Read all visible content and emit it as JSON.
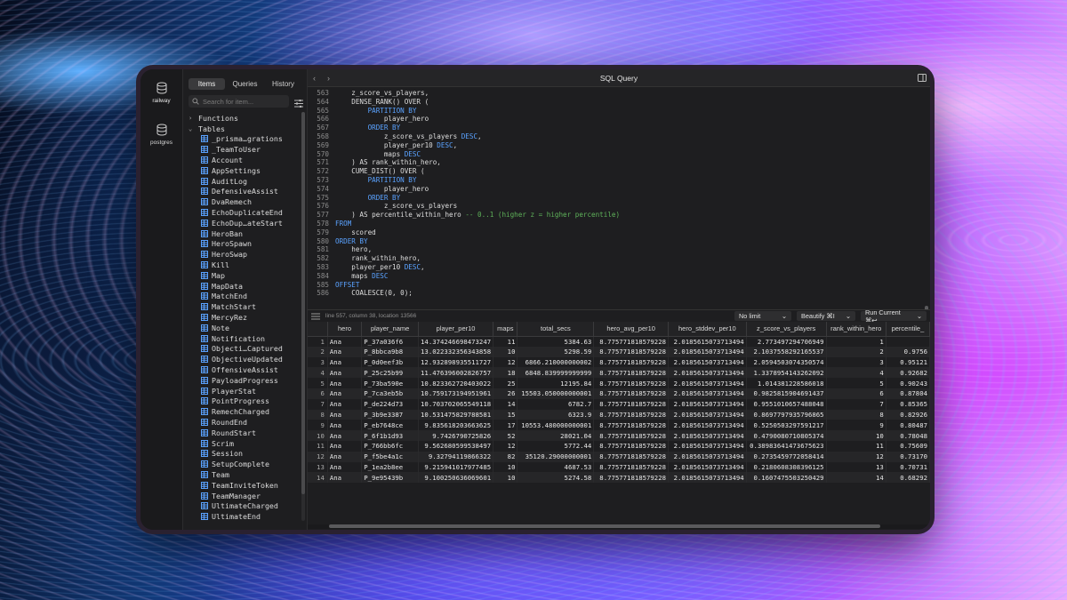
{
  "connections": [
    {
      "name": "railway",
      "active": true
    },
    {
      "name": "postgres",
      "active": false
    }
  ],
  "sidebar": {
    "tabs": [
      "Items",
      "Queries",
      "History"
    ],
    "active_tab": "Items",
    "search_placeholder": "Search for item...",
    "groups": [
      {
        "label": "Functions",
        "expanded": false
      },
      {
        "label": "Tables",
        "expanded": true
      }
    ],
    "tables": [
      "_prisma…grations",
      "_TeamToUser",
      "Account",
      "AppSettings",
      "AuditLog",
      "DefensiveAssist",
      "DvaRemech",
      "EchoDuplicateEnd",
      "EchoDup…ateStart",
      "HeroBan",
      "HeroSpawn",
      "HeroSwap",
      "Kill",
      "Map",
      "MapData",
      "MatchEnd",
      "MatchStart",
      "MercyRez",
      "Note",
      "Notification",
      "Objecti…Captured",
      "ObjectiveUpdated",
      "OffensiveAssist",
      "PayloadProgress",
      "PlayerStat",
      "PointProgress",
      "RemechCharged",
      "RoundEnd",
      "RoundStart",
      "Scrim",
      "Session",
      "SetupComplete",
      "Team",
      "TeamInviteToken",
      "TeamManager",
      "UltimateCharged",
      "UltimateEnd"
    ]
  },
  "editor": {
    "title": "SQL Query",
    "lines": [
      {
        "n": "563",
        "html": "    z_score_vs_players,"
      },
      {
        "n": "564",
        "html": "    DENSE_RANK() OVER ("
      },
      {
        "n": "565",
        "html": "        <span class=\"kw\">PARTITION BY</span>"
      },
      {
        "n": "566",
        "html": "            player_hero"
      },
      {
        "n": "567",
        "html": "        <span class=\"kw\">ORDER BY</span>"
      },
      {
        "n": "568",
        "html": "            z_score_vs_players <span class=\"kw\">DESC</span>,"
      },
      {
        "n": "569",
        "html": "            player_per10 <span class=\"kw\">DESC</span>,"
      },
      {
        "n": "570",
        "html": "            maps <span class=\"kw\">DESC</span>"
      },
      {
        "n": "571",
        "html": "    ) AS rank_within_hero,"
      },
      {
        "n": "572",
        "html": "    CUME_DIST() OVER ("
      },
      {
        "n": "573",
        "html": "        <span class=\"kw\">PARTITION BY</span>"
      },
      {
        "n": "574",
        "html": "            player_hero"
      },
      {
        "n": "575",
        "html": "        <span class=\"kw\">ORDER BY</span>"
      },
      {
        "n": "576",
        "html": "            z_score_vs_players"
      },
      {
        "n": "577",
        "html": "    ) AS percentile_within_hero <span class=\"cm\">-- 0..1 (higher z = higher percentile)</span>"
      },
      {
        "n": "578",
        "html": "<span class=\"kw\">FROM</span>"
      },
      {
        "n": "579",
        "html": "    scored"
      },
      {
        "n": "580",
        "html": "<span class=\"kw\">ORDER BY</span>"
      },
      {
        "n": "581",
        "html": "    hero,"
      },
      {
        "n": "582",
        "html": "    rank_within_hero,"
      },
      {
        "n": "583",
        "html": "    player_per10 <span class=\"kw\">DESC</span>,"
      },
      {
        "n": "584",
        "html": "    maps <span class=\"kw\">DESC</span>"
      },
      {
        "n": "585",
        "html": "<span class=\"kw\">OFFSET</span>"
      },
      {
        "n": "586",
        "html": "    COALESCE(0, 0);"
      }
    ]
  },
  "status": {
    "cursor": "line 557, column 38, location 13566",
    "limit_label": "No limit",
    "beautify_label": "Beautify ⌘I",
    "run_label": "Run Current ⌘↩"
  },
  "results": {
    "columns": [
      "hero",
      "player_name",
      "player_per10",
      "maps",
      "total_secs",
      "hero_avg_per10",
      "hero_stddev_per10",
      "z_score_vs_players",
      "rank_within_hero",
      "percentile_"
    ],
    "rows": [
      [
        "1",
        "Ana",
        "P_37a036f6",
        "14.374246698473247",
        "11",
        "5384.63",
        "8.775771818579228",
        "2.0185615073713494",
        "2.773497294706949",
        "1",
        ""
      ],
      [
        "2",
        "Ana",
        "P_8bbca9b8",
        "13.022332356343858",
        "10",
        "5298.59",
        "8.775771818579228",
        "2.0185615073713494",
        "2.1037558292165537",
        "2",
        "0.9756"
      ],
      [
        "3",
        "Ana",
        "P_0d0eef3b",
        "12.932898935511727",
        "12",
        "6866.210000000002",
        "8.775771818579228",
        "2.0185615073713494",
        "2.0594503074350574",
        "3",
        "0.95121"
      ],
      [
        "4",
        "Ana",
        "P_25c25b99",
        "11.476396002826757",
        "18",
        "6848.839999999999",
        "8.775771818579228",
        "2.0185615073713494",
        "1.3378954143262092",
        "4",
        "0.92682"
      ],
      [
        "5",
        "Ana",
        "P_73ba590e",
        "10.823362720403022",
        "25",
        "12195.84",
        "8.775771818579228",
        "2.0185615073713494",
        "1.014381228586018",
        "5",
        "0.90243"
      ],
      [
        "6",
        "Ana",
        "P_7ca3eb5b",
        "10.759173194951961",
        "26",
        "15503.050000000001",
        "8.775771818579228",
        "2.0185615073713494",
        "0.9825815904691437",
        "6",
        "0.87804"
      ],
      [
        "7",
        "Ana",
        "P_de224d73",
        "10.703702065549118",
        "14",
        "6782.7",
        "8.775771818579228",
        "2.0185615073713494",
        "0.9551010657488048",
        "7",
        "0.85365"
      ],
      [
        "8",
        "Ana",
        "P_3b9e3387",
        "10.531475829788581",
        "15",
        "6323.9",
        "8.775771818579228",
        "2.0185615073713494",
        "0.8697797935796865",
        "8",
        "0.82926"
      ],
      [
        "9",
        "Ana",
        "P_eb7648ce",
        "9.835618203663625",
        "17",
        "10553.480000000001",
        "8.775771818579228",
        "2.0185615073713494",
        "0.5250503297591217",
        "9",
        "0.80487"
      ],
      [
        "10",
        "Ana",
        "P_6f1b1d93",
        "9.7426790725826",
        "52",
        "28021.04",
        "8.775771818579228",
        "2.0185615073713494",
        "0.4790080710805374",
        "10",
        "0.78048"
      ],
      [
        "11",
        "Ana",
        "P_766bb6fc",
        "9.562680599538497",
        "12",
        "5772.44",
        "8.775771818579228",
        "2.0185615073713494",
        "0.38983641473675623",
        "11",
        "0.75609"
      ],
      [
        "12",
        "Ana",
        "P_f5be4a1c",
        "9.32794119866322",
        "82",
        "35120.29000000001",
        "8.775771818579228",
        "2.0185615073713494",
        "0.2735459772058414",
        "12",
        "0.73170"
      ],
      [
        "13",
        "Ana",
        "P_1ea2b8ee",
        "9.215941017977485",
        "10",
        "4687.53",
        "8.775771818579228",
        "2.0185615073713494",
        "0.2180608308396125",
        "13",
        "0.70731"
      ],
      [
        "14",
        "Ana",
        "P_9e95439b",
        "9.100250636069601",
        "10",
        "5274.58",
        "8.775771818579228",
        "2.0185615073713494",
        "0.1607475503250429",
        "14",
        "0.68292"
      ]
    ]
  }
}
